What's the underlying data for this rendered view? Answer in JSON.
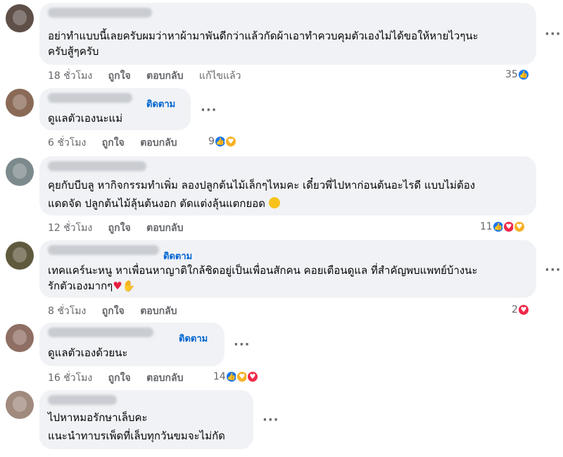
{
  "labels": {
    "like": "ถูกใจ",
    "reply": "ตอบกลับ",
    "edited": "แก้ไขแล้ว",
    "follow": "ติดตาม",
    "more": "···"
  },
  "colors": {
    "bubble": "#f0f2f5",
    "meta": "#65676b",
    "follow": "#0064d1",
    "like": "#1877f2",
    "love": "#f02849",
    "care": "#f7b125"
  },
  "comments": [
    {
      "lines": [
        "อย่าทำแบบนี้เลยครับผมว่าหาผ้ามาพันดีกว่าแล้วกัดผ้าเอาทำควบคุมตัวเองไม่ได้ขอให้หายไวๆนะ",
        "ครับสู้ๆครับ"
      ],
      "time": "18 ชั่วโมง",
      "reactions": "35",
      "reaction_icons": [
        "like-icon"
      ],
      "edited": true,
      "follow": false
    },
    {
      "lines": [
        "ดูแลตัวเองนะแม่"
      ],
      "time": "6 ชั่วโมง",
      "reactions": "9",
      "reaction_icons": [
        "like-icon",
        "care-icon"
      ],
      "edited": false,
      "follow": true
    },
    {
      "lines": [
        "คุยกับบีบลู หากิจกรรมทำเพิ่ม ลองปลูกต้นไม้เล็กๆไหมคะ เดี๋ยวพี่ไปหาก่อนต้นอะไรดี แบบไม่ต้อง",
        "แดดจัด ปลูกต้นไม้ลุ้นต้นงอก ตัดแต่งลุ้นแตกยอด"
      ],
      "time": "12 ชั่วโมง",
      "reactions": "11",
      "reaction_icons": [
        "like-icon",
        "love-icon",
        "care-icon"
      ],
      "edited": false,
      "follow": false
    },
    {
      "lines": [
        "เทคแคร์นะหนู หาเพื่อนหาญาติใกล้ชิดอยู่เป็นเพื่อนสักคน คอยเตือนดูแล ที่สำคัญพบแพทย์บ้างนะ",
        "รักตัวเองมากๆ"
      ],
      "time": "8 ชั่วโมง",
      "reactions": "2",
      "reaction_icons": [
        "love-icon"
      ],
      "edited": false,
      "follow": true
    },
    {
      "lines": [
        "ดูแลตัวเองด้วยนะ"
      ],
      "time": "16 ชั่วโมง",
      "reactions": "14",
      "reaction_icons": [
        "like-icon",
        "care-icon",
        "love-icon"
      ],
      "edited": false,
      "follow": true
    },
    {
      "lines": [
        "ไปหาหมอรักษาเล็บคะ",
        "แนะนำทาบรเพ็ดที่เล็บทุกวันขมจะไม่กัด"
      ],
      "time": "",
      "reactions": "",
      "reaction_icons": [],
      "edited": false,
      "follow": false
    }
  ]
}
